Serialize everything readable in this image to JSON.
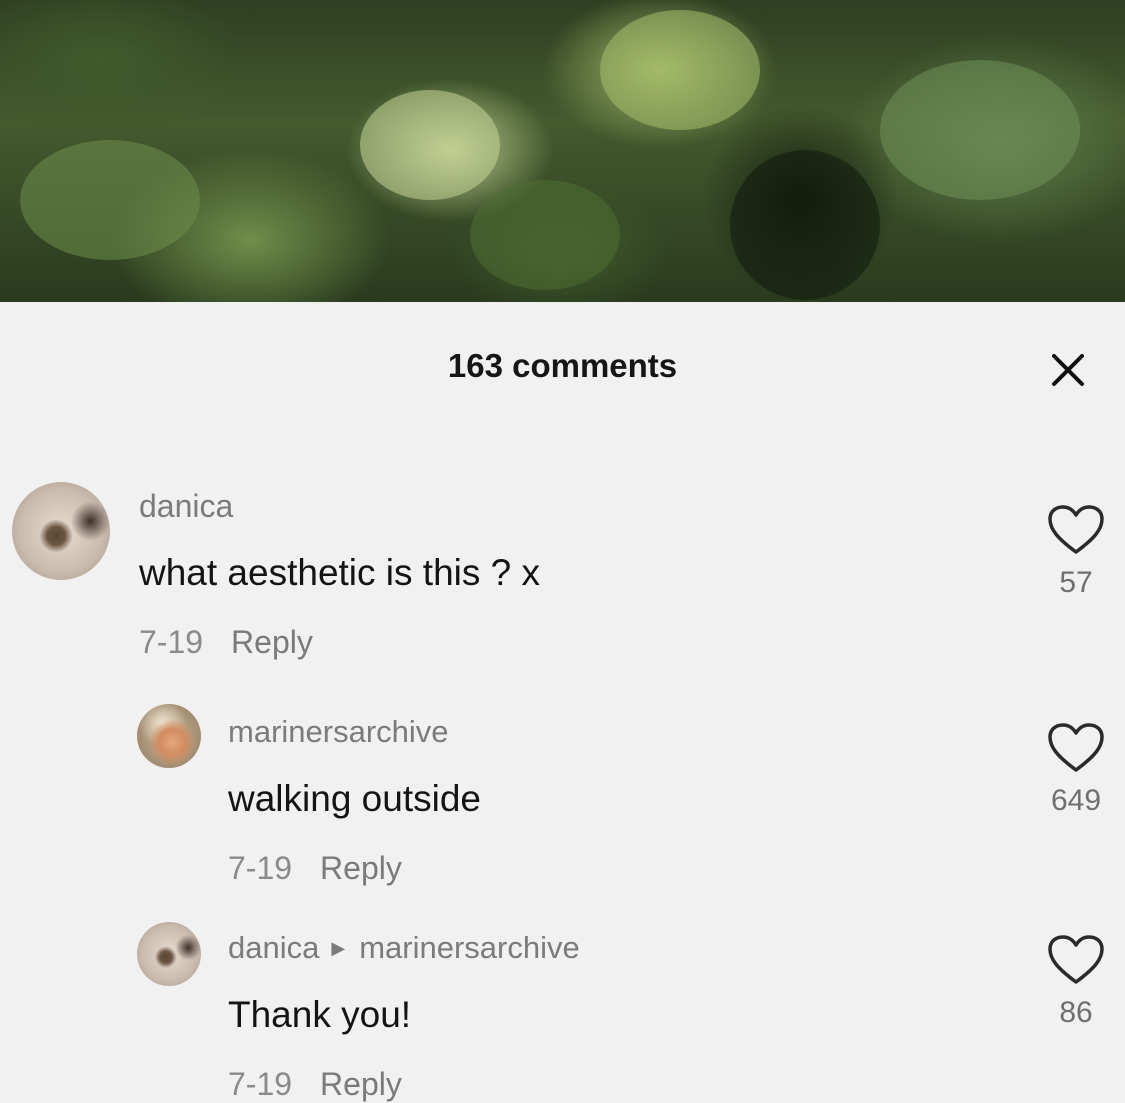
{
  "video": {
    "icon": "forest-video-thumbnail"
  },
  "header": {
    "title": "163 comments",
    "close_icon": "close-icon"
  },
  "comments": [
    {
      "username": "danica",
      "text": "what aesthetic is this ? x",
      "date": "7-19",
      "reply_label": "Reply",
      "likes": "57"
    },
    {
      "username": "marinersarchive",
      "text": "walking outside",
      "date": "7-19",
      "reply_label": "Reply",
      "likes": "649"
    },
    {
      "username": "danica",
      "reply_to": "marinersarchive",
      "text": "Thank you!",
      "date": "7-19",
      "reply_label": "Reply",
      "likes": "86"
    }
  ],
  "colors": {
    "background": "#f1f1f1",
    "username": "#7b7b7b",
    "text": "#141414"
  }
}
